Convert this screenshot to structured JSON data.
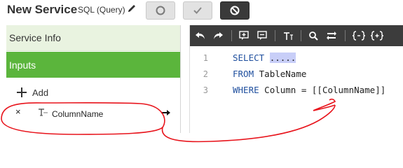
{
  "header": {
    "title": "New Service",
    "subtitle": "SQL (Query)",
    "edit_icon": "pencil-icon",
    "buttons": [
      {
        "icon": "circle-icon"
      },
      {
        "icon": "checkmark-icon"
      },
      {
        "icon": "cancel-icon"
      }
    ]
  },
  "sidebar": {
    "items": [
      {
        "label": "Service Info"
      },
      {
        "label": "Inputs"
      }
    ],
    "add_label": "Add",
    "input_item": {
      "close_icon": "close-icon",
      "close_glyph": "×",
      "type_icon": "text-type-icon",
      "name": "ColumnName",
      "arrow_icon": "arrow-right-icon"
    }
  },
  "editor": {
    "toolbar_icons": [
      "undo-icon",
      "redo-icon",
      "insert-comment-icon",
      "comment-icon",
      "text-format-icon",
      "search-icon",
      "replace-icon",
      "brackets-icon",
      "insert-parameter-icon"
    ],
    "lines": [
      {
        "num": "1",
        "kw": "SELECT",
        "sel": "....."
      },
      {
        "num": "2",
        "kw": "FROM",
        "rest": "TableName"
      },
      {
        "num": "3",
        "kw": "WHERE",
        "rest": "Column = [[ColumnName]]"
      }
    ]
  },
  "colors": {
    "accent": "#5bb53c",
    "accent_light": "#e9f3e0",
    "toolbar_bg": "#3c3c3c",
    "keyword": "#1f4f9e",
    "annotation": "#e8141c"
  }
}
